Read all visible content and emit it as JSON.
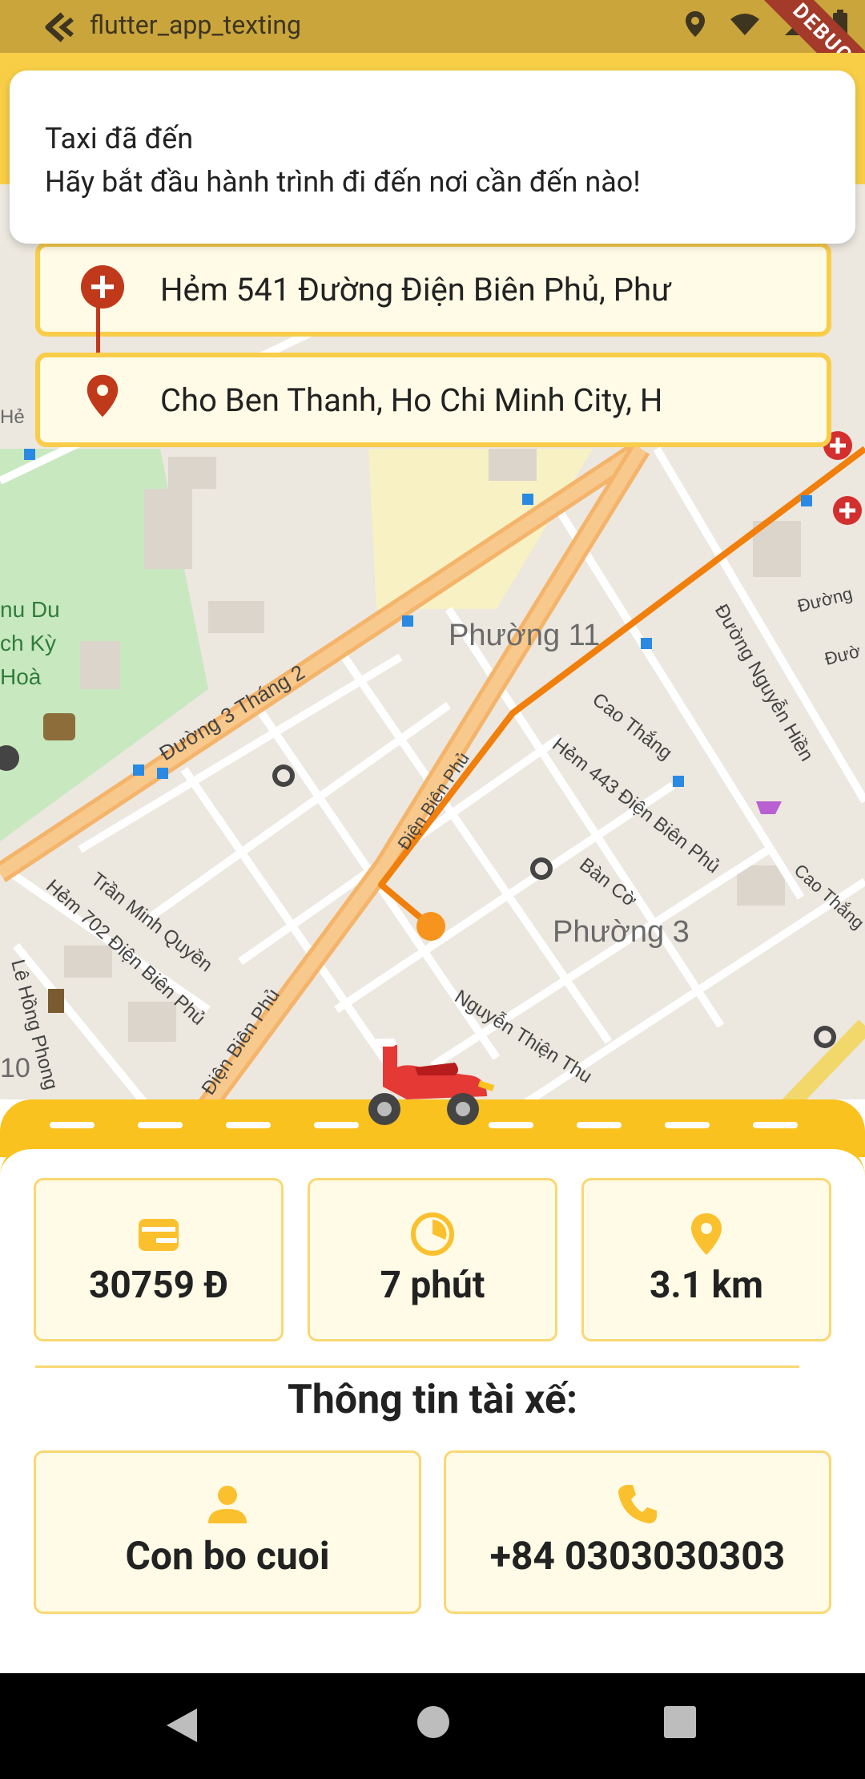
{
  "status_bar": {
    "app_title": "flutter_app_texting",
    "debug_label": "DEBUG",
    "icons": [
      "back-arrow-icon",
      "location-icon",
      "wifi-icon",
      "signal-icon",
      "battery-icon"
    ]
  },
  "notification": {
    "line1": "Taxi đã đến",
    "line2": "Hãy bắt đầu hành trình đi đến nơi cần đến nào!"
  },
  "route": {
    "origin": "Hẻm 541 Đường Điện Biên Phủ, Phư",
    "destination": "Cho Ben Thanh, Ho Chi Minh City, H"
  },
  "map_labels": {
    "ward11": "Phường 11",
    "ward3": "Phường 3",
    "street_3thang2": "Đường 3 Tháng 2",
    "street_caothang": "Cao Thắng",
    "street_hem443": "Hẻm 443 Điện Biên Phủ",
    "street_nguyenhien": "Đường Nguyễn Hiền",
    "street_tranminhquyen": "Trần Minh Quyền",
    "street_hem702": "Hẻm 702 Điện Biên Phủ",
    "street_nguyenthienthuat": "Nguyễn Thiện Thu",
    "street_dienbienphu": "Điện Biên Phủ",
    "street_lehongphong": "Lê Hồng Phong",
    "street_bancco": "Bàn Cờ",
    "park_line1": "nu Du",
    "park_line2": "ch Kỳ",
    "park_line3": "Hoà",
    "left_code": "Hẻ",
    "num10": "10",
    "duong_r1": "Đường",
    "duong_r2": "Đườ",
    "cao_thang_r": "Cao Thắng",
    "dbp_diag": "Điện Biên Phủ"
  },
  "trip": {
    "price": "30759 Đ",
    "duration": "7 phút",
    "distance": "3.1 km"
  },
  "driver": {
    "section_title": "Thông tin tài xế:",
    "name": "Con bo cuoi",
    "phone": "+84 0303030303"
  },
  "colors": {
    "accent": "#f9c21e",
    "route": "#f07f0c",
    "card_bg": "#fffbe6",
    "marker": "#c0391b"
  }
}
